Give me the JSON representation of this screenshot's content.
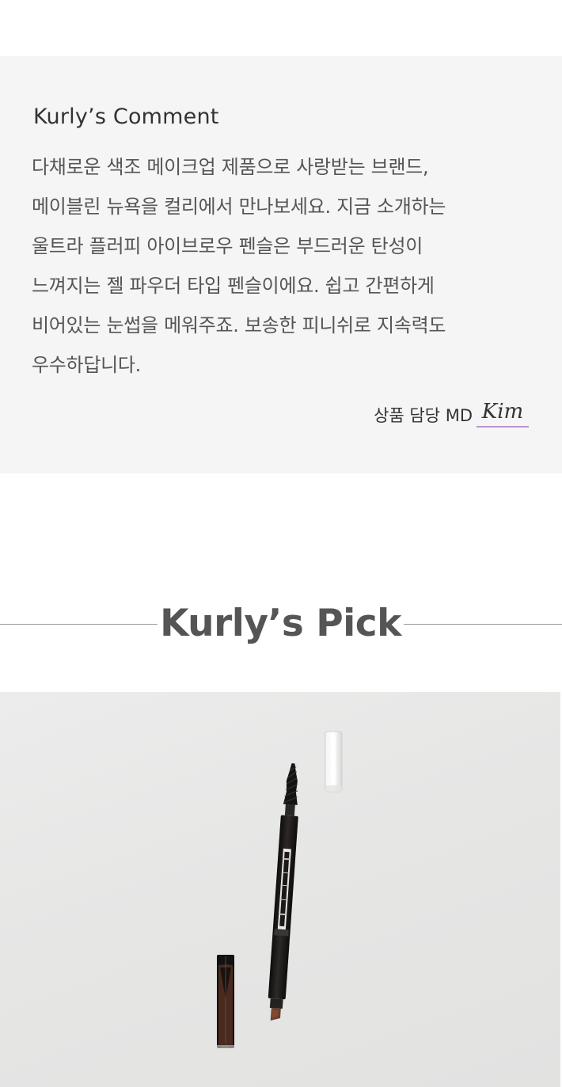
{
  "comment": {
    "title": "Kurly’s Comment",
    "lines": [
      "다채로운 색조 메이크업 제품으로 사랑받는 브랜드,",
      "메이블린 뉴욕을 컬리에서 만나보세요. 지금 소개하는",
      "울트라 플러피 아이브로우 펜슬은 부드러운 탄성이",
      "느껴지는 젤 파우더 타입 펜슬이에요. 쉽고 간편하게",
      "비어있는 눈썹을 메워주죠. 보송한 피니쉬로 지속력도",
      "우수하답니다."
    ],
    "signature_label": "상품 담당 MD",
    "signature_name": "Kim",
    "underline_color": "#b995cf"
  },
  "pick": {
    "title": "Kurly’s Pick"
  },
  "product_image": {
    "subject": "eyebrow pencil with spoolie brush, cap and clear cap on light grey background",
    "background_color": "#e8e8e7",
    "pencil_color": "#1c1a19",
    "tip_color": "#6b3d28"
  }
}
